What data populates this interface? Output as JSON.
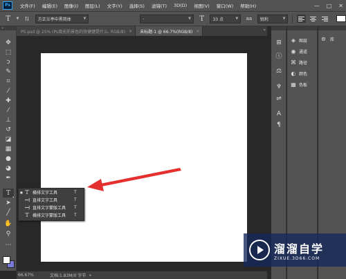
{
  "app": {
    "logo": "Ps"
  },
  "menu": [
    "文件(F)",
    "编辑(E)",
    "图像(I)",
    "图层(L)",
    "文字(Y)",
    "选择(S)",
    "滤镜(T)",
    "3D(D)",
    "视图(V)",
    "窗口(W)",
    "帮助(H)"
  ],
  "window_controls": {
    "minimize": "—",
    "maximize": "□",
    "close": "✕"
  },
  "options": {
    "tool_icon": "T",
    "font_family": "方正兰亭中黑简体",
    "font_style": "-",
    "size_icon": "T",
    "font_size": "33 点",
    "aa_label": "aa",
    "antialias": "锐利",
    "text_color": "#ffffff"
  },
  "tabs": [
    {
      "label": "PS.psd @ 25% (Ps填充前景色的快捷键是什么, RGB/8)",
      "close": "×"
    },
    {
      "label": "未标题-1 @ 66.7%(RGB/8)",
      "close": "×"
    }
  ],
  "tabbar_collapse": "»",
  "toolbar": {
    "collapse": "»",
    "selected_tool": "type-tool",
    "tools": [
      {
        "name": "move-tool",
        "glyph": "✥"
      },
      {
        "name": "marquee-tool",
        "glyph": "⬚"
      },
      {
        "name": "lasso-tool",
        "glyph": "ↄ"
      },
      {
        "name": "quick-select-tool",
        "glyph": "✎"
      },
      {
        "name": "crop-tool",
        "glyph": "⌗"
      },
      {
        "name": "eyedropper-tool",
        "glyph": "⁄"
      },
      {
        "name": "healing-tool",
        "glyph": "✚"
      },
      {
        "name": "brush-tool",
        "glyph": "⁄"
      },
      {
        "name": "stamp-tool",
        "glyph": "⊥"
      },
      {
        "name": "history-brush-tool",
        "glyph": "↺"
      },
      {
        "name": "eraser-tool",
        "glyph": "◪"
      },
      {
        "name": "gradient-tool",
        "glyph": "▦"
      },
      {
        "name": "blur-tool",
        "glyph": "●"
      },
      {
        "name": "dodge-tool",
        "glyph": "◕"
      },
      {
        "name": "pen-tool",
        "glyph": "✒"
      },
      {
        "name": "type-tool",
        "glyph": "T"
      },
      {
        "name": "path-select-tool",
        "glyph": "➤"
      },
      {
        "name": "shape-tool",
        "glyph": "╱"
      },
      {
        "name": "hand-tool",
        "glyph": "✋"
      },
      {
        "name": "zoom-tool",
        "glyph": "⚲"
      },
      {
        "name": "extra-tools",
        "glyph": "⋯"
      }
    ],
    "foreground_color": "#ffffff",
    "background_color": "#7b7bd6"
  },
  "flyout": [
    {
      "label": "横排文字工具",
      "key": "T",
      "selected": true,
      "icon": "T"
    },
    {
      "label": "直排文字工具",
      "key": "T",
      "selected": false,
      "icon": "T"
    },
    {
      "label": "直排文字蒙版工具",
      "key": "T",
      "selected": false,
      "icon": "T"
    },
    {
      "label": "横排文字蒙版工具",
      "key": "T",
      "selected": false,
      "icon": "T"
    }
  ],
  "statusbar": {
    "zoom": "66.67%",
    "doc": "文档:1.83M/0 字节",
    "more": "▸"
  },
  "icon_strip": [
    {
      "name": "history-icon",
      "glyph": "⊞"
    },
    {
      "name": "info-icon",
      "glyph": "ⓘ"
    },
    {
      "name": "clone-source-icon",
      "glyph": "⚖"
    },
    {
      "name": "brush-preset-icon",
      "glyph": "♆"
    },
    {
      "name": "properties-icon",
      "glyph": "⇌"
    },
    {
      "name": "character-icon",
      "glyph": "A"
    },
    {
      "name": "paragraph-icon",
      "glyph": "¶"
    }
  ],
  "panels": [
    {
      "label": "图层",
      "icon": "◈"
    },
    {
      "label": "通道",
      "icon": "◉"
    },
    {
      "label": "路径",
      "icon": "⌘"
    },
    {
      "label": "颜色",
      "icon": "◐"
    },
    {
      "label": "色板",
      "icon": "▦"
    }
  ],
  "library": {
    "label": "库",
    "icon": "⊚"
  },
  "watermark": {
    "title": "溜溜自学",
    "url": "ZIXUE.3D66.COM"
  }
}
